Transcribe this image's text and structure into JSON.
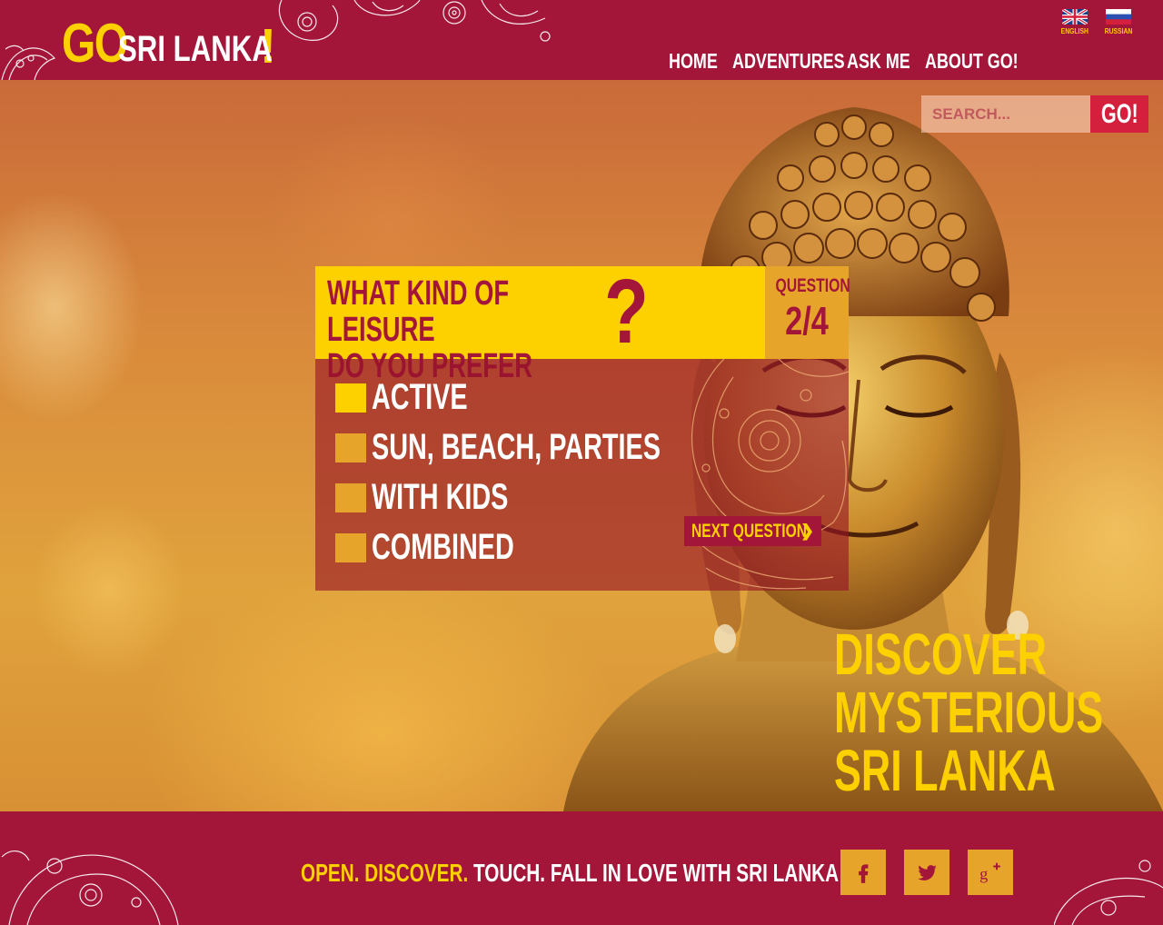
{
  "header": {
    "logo": {
      "go": "GO",
      "rest": "SRI LANKA",
      "excl": "!"
    },
    "languages": [
      {
        "label": "ENGLISH"
      },
      {
        "label": "RUSSIAN"
      }
    ],
    "nav": [
      {
        "label": "HOME"
      },
      {
        "label": "ADVENTURES"
      },
      {
        "label": "ASK ME"
      },
      {
        "label": "ABOUT GO!"
      }
    ]
  },
  "search": {
    "placeholder": "SEARCH...",
    "button": "GO!"
  },
  "quiz": {
    "question_line1": "WHAT KIND OF LEISURE",
    "question_line2": "DO YOU PREFER",
    "mark": "?",
    "counter_label": "QUESTION",
    "counter_value": "2/4",
    "options": [
      {
        "label": "ACTIVE",
        "selected": true
      },
      {
        "label": "SUN, BEACH, PARTIES",
        "selected": false
      },
      {
        "label": "WITH KIDS",
        "selected": false
      },
      {
        "label": "COMBINED",
        "selected": false
      }
    ],
    "next_label": "NEXT QUESTION",
    "next_icon": "chevron-right-icon"
  },
  "hero": {
    "discover": [
      "DISCOVER",
      "MYSTERIOUS",
      "SRI LANKA"
    ]
  },
  "footer": {
    "tagline": {
      "open": "OPEN.",
      "discover": "DISCOVER.",
      "rest": "TOUCH. FALL IN LOVE WITH SRI LANKA"
    },
    "social": [
      {
        "icon": "facebook-icon"
      },
      {
        "icon": "twitter-icon"
      },
      {
        "icon": "google-plus-icon"
      }
    ]
  },
  "colors": {
    "brand_crimson": "#a3163a",
    "brand_yellow": "#fdd000",
    "accent_orange": "#e6a52a",
    "button_red": "#d41f3d"
  }
}
